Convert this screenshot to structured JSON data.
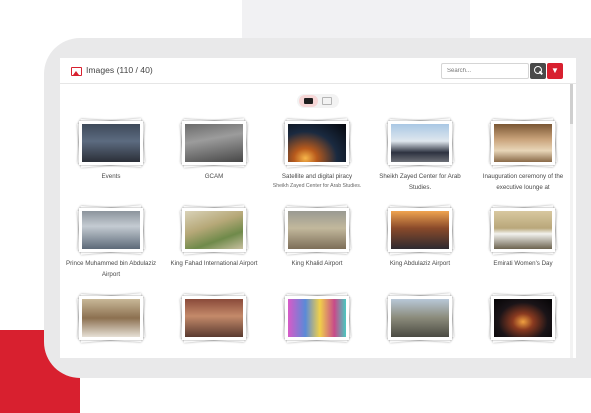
{
  "panel": {
    "title": "Images (110 / 40)",
    "search_placeholder": "Search..."
  },
  "icons": {
    "header": "image-icon",
    "search": "search-icon",
    "dropdown": "chevron-down-icon",
    "folder_view": "folder-icon",
    "grid_view": "grid-icon"
  },
  "colors": {
    "accent": "#d8202f",
    "dark_button": "#4a4a4a"
  },
  "albums": [
    {
      "label": "Events",
      "sublabel": ""
    },
    {
      "label": "GCAM",
      "sublabel": ""
    },
    {
      "label": "Satellite and digital piracy",
      "sublabel": "Sheikh Zayed Center for Arab Studies."
    },
    {
      "label": "Sheikh Zayed Center for Arab Studies.",
      "sublabel": ""
    },
    {
      "label": "Inauguration ceremony of the executive lounge at",
      "sublabel": ""
    },
    {
      "label": "Prince Muhammed bin Abdulaziz Airport",
      "sublabel": ""
    },
    {
      "label": "King Fahad International Airport",
      "sublabel": ""
    },
    {
      "label": "King Khalid Airport",
      "sublabel": ""
    },
    {
      "label": "King Abdulaziz Airport",
      "sublabel": ""
    },
    {
      "label": "Emirati Women's Day",
      "sublabel": ""
    },
    {
      "label": "",
      "sublabel": ""
    },
    {
      "label": "",
      "sublabel": ""
    },
    {
      "label": "",
      "sublabel": ""
    },
    {
      "label": "",
      "sublabel": ""
    },
    {
      "label": "",
      "sublabel": ""
    }
  ]
}
